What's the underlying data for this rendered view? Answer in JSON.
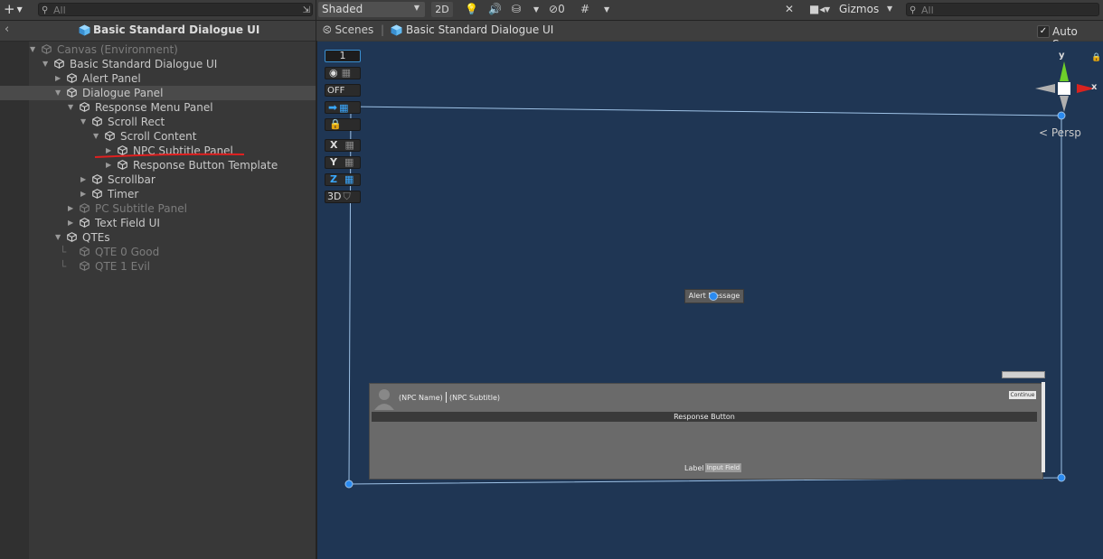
{
  "hierarchy": {
    "search_placeholder": "All",
    "header_title": "Basic Standard Dialogue UI",
    "items": [
      {
        "label": "Canvas (Environment)",
        "depth": 0,
        "expanded": true,
        "dim": true
      },
      {
        "label": "Basic Standard Dialogue UI",
        "depth": 1,
        "expanded": true,
        "dim": false
      },
      {
        "label": "Alert Panel",
        "depth": 2,
        "expanded": false,
        "dim": false
      },
      {
        "label": "Dialogue Panel",
        "depth": 2,
        "expanded": true,
        "dim": false,
        "selected": true
      },
      {
        "label": "Response Menu Panel",
        "depth": 3,
        "expanded": true,
        "dim": false
      },
      {
        "label": "Scroll Rect",
        "depth": 4,
        "expanded": true,
        "dim": false
      },
      {
        "label": "Scroll Content",
        "depth": 5,
        "expanded": true,
        "dim": false
      },
      {
        "label": "NPC Subtitle Panel",
        "depth": 6,
        "expanded": false,
        "dim": false,
        "underlined": true
      },
      {
        "label": "Response Button Template",
        "depth": 6,
        "expanded": false,
        "dim": false
      },
      {
        "label": "Scrollbar",
        "depth": 4,
        "expanded": false,
        "dim": false
      },
      {
        "label": "Timer",
        "depth": 4,
        "expanded": false,
        "dim": false
      },
      {
        "label": "PC Subtitle Panel",
        "depth": 3,
        "expanded": false,
        "dim": true
      },
      {
        "label": "Text Field UI",
        "depth": 3,
        "expanded": false,
        "dim": false
      },
      {
        "label": "QTEs",
        "depth": 2,
        "expanded": true,
        "dim": false
      },
      {
        "label": "QTE 0 Good",
        "depth": 3,
        "leaf": true,
        "dim": true
      },
      {
        "label": "QTE 1 Evil",
        "depth": 3,
        "leaf": true,
        "dim": true
      }
    ]
  },
  "scene_toolbar": {
    "shading_mode": "Shaded",
    "toggle_2d": "2D",
    "hidden_count": "0",
    "gizmos_label": "Gizmos",
    "search_placeholder": "All"
  },
  "scene_tabbar": {
    "tab_scenes": "Scenes",
    "breadcrumb": "Basic Standard Dialogue UI",
    "auto_save_label": "Auto Save",
    "auto_save_checked": true
  },
  "viewport": {
    "tools": {
      "layer_number": "1",
      "off_label": "OFF",
      "x_label": "X",
      "y_label": "Y",
      "z_label": "Z",
      "label_3d": "3D"
    },
    "gizmo": {
      "y_label": "y",
      "x_label": "x",
      "projection": "Persp"
    },
    "alert_message": "Alert Message",
    "npc_name": "(NPC Name)",
    "npc_subtitle": "(NPC Subtitle)",
    "continue_label": "Continue",
    "response_button": "Response Button",
    "label_text": "Label",
    "input_field": "Input Field"
  },
  "colors": {
    "viewport_bg": "#1f3654",
    "accent": "#2a8af0",
    "gizmo_y": "#6ecf2a",
    "gizmo_x": "#d8231f"
  }
}
